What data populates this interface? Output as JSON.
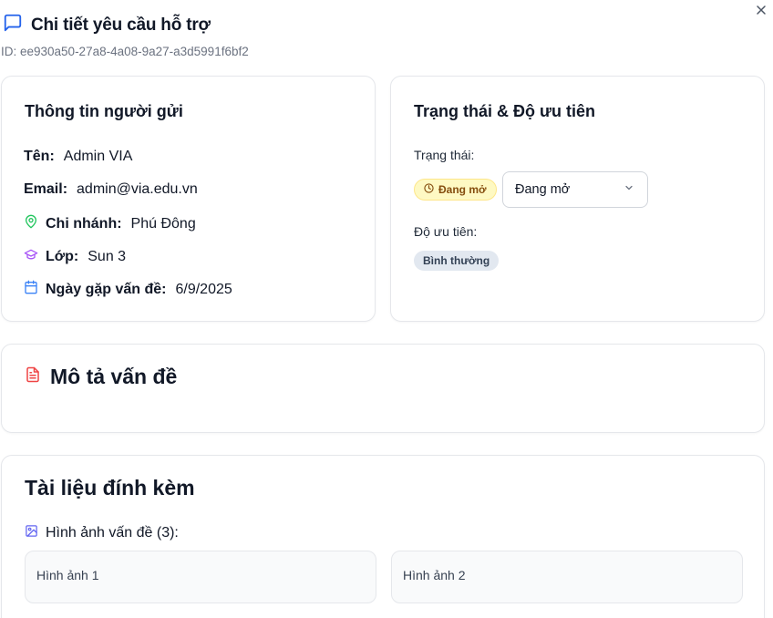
{
  "header": {
    "title": "Chi tiết yêu cầu hỗ trợ",
    "id_text": "ID: ee930a50-27a8-4a08-9a27-a3d5991f6bf2"
  },
  "sender": {
    "heading": "Thông tin người gửi",
    "name_label": "Tên:",
    "name_value": "Admin VIA",
    "email_label": "Email:",
    "email_value": "admin@via.edu.vn",
    "branch_label": "Chi nhánh:",
    "branch_value": "Phú Đông",
    "class_label": "Lớp:",
    "class_value": "Sun 3",
    "date_label": "Ngày gặp vấn đề:",
    "date_value": "6/9/2025"
  },
  "status": {
    "heading": "Trạng thái & Độ ưu tiên",
    "status_label": "Trạng thái:",
    "status_badge": "Đang mở",
    "status_select": "Đang mở",
    "priority_label": "Độ ưu tiên:",
    "priority_badge": "Bình thường"
  },
  "description": {
    "heading": "Mô tả vấn đề"
  },
  "attachments": {
    "heading": "Tài liệu đính kèm",
    "images_label": "Hình ảnh vấn đề (3):",
    "images": [
      "Hình ảnh 1",
      "Hình ảnh 2"
    ]
  },
  "icons": {
    "header": "message-square-icon",
    "close": "close-icon",
    "branch": "map-pin-icon",
    "class": "graduation-cap-icon",
    "date": "calendar-icon",
    "status": "clock-icon",
    "select": "chevron-down-icon",
    "description": "file-text-icon",
    "images": "image-icon"
  },
  "colors": {
    "accent_blue": "#2563eb",
    "pin_green": "#22c55e",
    "cap_purple": "#a855f7",
    "calendar_blue": "#3b82f6",
    "file_red": "#ef4444",
    "image_indigo": "#6366f1",
    "badge_yellow_bg": "#fef9c3",
    "badge_gray_bg": "#e2e8f0"
  }
}
